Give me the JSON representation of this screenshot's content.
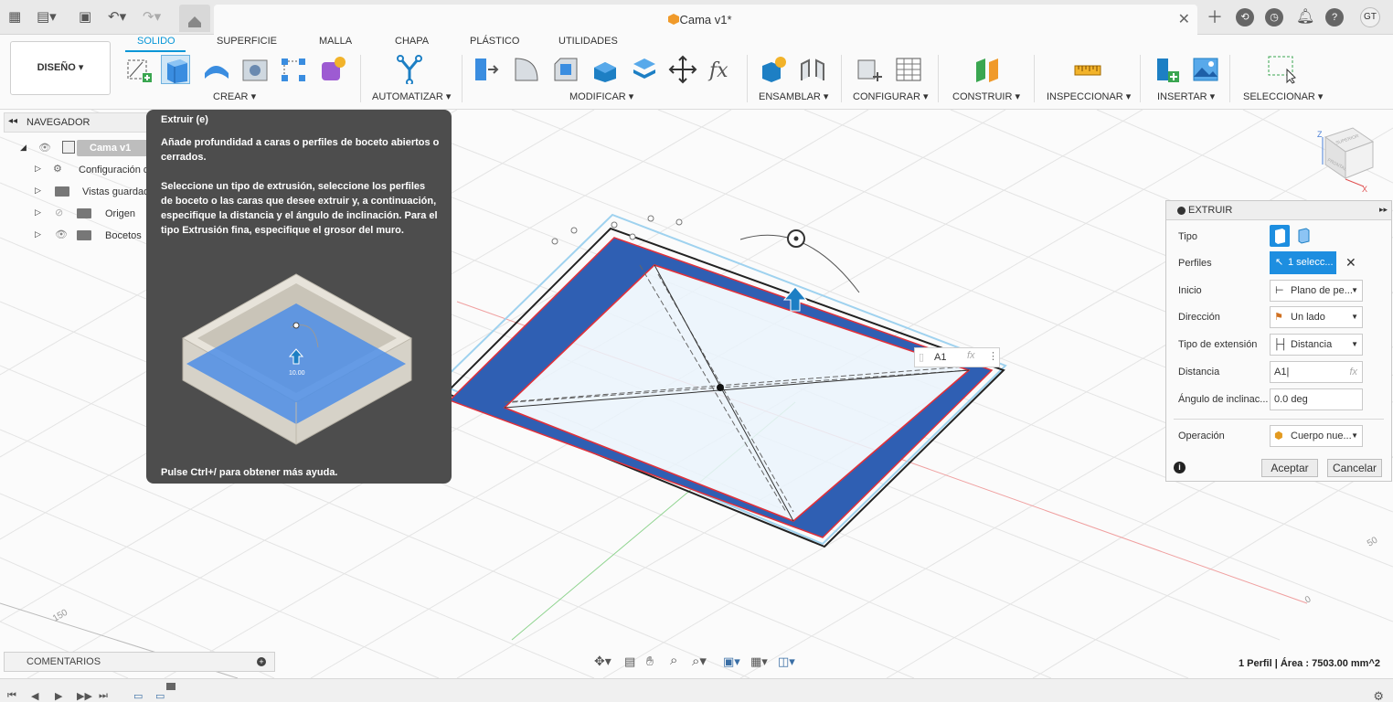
{
  "titlebar": {
    "doc_title": "Cama v1*",
    "user_initials": "GT"
  },
  "ribbon": {
    "workspace": "DISEÑO",
    "tabs": [
      "SOLIDO",
      "SUPERFICIE",
      "MALLA",
      "CHAPA",
      "PLÁSTICO",
      "UTILIDADES"
    ],
    "groups": [
      "CREAR",
      "AUTOMATIZAR",
      "MODIFICAR",
      "ENSAMBLAR",
      "CONFIGURAR",
      "CONSTRUIR",
      "INSPECCIONAR",
      "INSERTAR",
      "SELECCIONAR"
    ]
  },
  "navigator": {
    "title": "NAVEGADOR",
    "root": "Cama v1",
    "items": [
      "Configuración d",
      "Vistas guardad",
      "Origen",
      "Bocetos"
    ]
  },
  "tooltip": {
    "title": "Extruir (e)",
    "para1": "Añade profundidad a caras o perfiles de boceto abiertos o cerrados.",
    "para2": "Seleccione un tipo de extrusión, seleccione los perfiles de boceto o las caras que desee extruir y, a continuación, especifique la distancia y el ángulo de inclinación. Para el tipo Extrusión fina, especifique el grosor del muro.",
    "footer": "Pulse Ctrl+/ para obtener más ayuda.",
    "illustration_label": "10.00"
  },
  "extrude": {
    "title": "EXTRUIR",
    "rows": {
      "tipo": "Tipo",
      "perfiles": "Perfiles",
      "inicio": "Inicio",
      "direccion": "Dirección",
      "tipo_extension": "Tipo de extensión",
      "distancia": "Distancia",
      "angulo": "Ángulo de inclinac...",
      "operacion": "Operación"
    },
    "values": {
      "perfiles": "1 selecc...",
      "inicio": "Plano de pe...",
      "direccion": "Un lado",
      "tipo_extension": "Distancia",
      "distancia": "A1",
      "angulo": "0.0 deg",
      "operacion": "Cuerpo nue..."
    },
    "buttons": {
      "ok": "Aceptar",
      "cancel": "Cancelar"
    }
  },
  "canvas": {
    "dimension_input": "A1",
    "fx": "fx",
    "axis_labels": [
      "150",
      "50",
      "0"
    ],
    "viewcube": [
      "SUPERIOR",
      "FRONTAL",
      "Z",
      "X"
    ]
  },
  "bottom": {
    "comments": "COMENTARIOS",
    "status": "1 Perfil | Área : 7503.00 mm^2"
  },
  "colors": {
    "accent": "#0696d7",
    "profile_blue": "#2f5fb3",
    "tooltip_bg": "#4d4d4d"
  }
}
